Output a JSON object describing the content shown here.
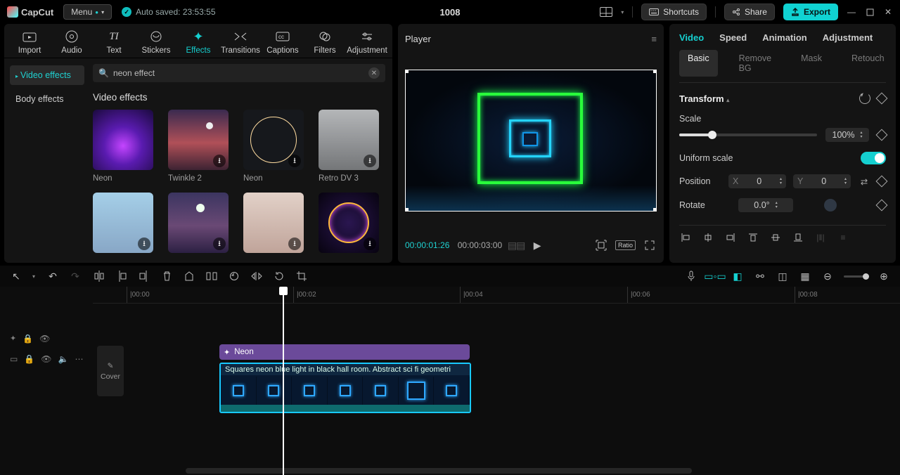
{
  "app": {
    "name": "CapCut",
    "menu": "Menu",
    "autosave": "Auto saved: 23:53:55",
    "project": "1008"
  },
  "topbar": {
    "shortcuts": "Shortcuts",
    "share": "Share",
    "export": "Export"
  },
  "media_tabs": {
    "import": "Import",
    "audio": "Audio",
    "text": "Text",
    "stickers": "Stickers",
    "effects": "Effects",
    "transitions": "Transitions",
    "captions": "Captions",
    "filters": "Filters",
    "adjustment": "Adjustment"
  },
  "media_sidebar": {
    "video_effects": "Video effects",
    "body_effects": "Body effects"
  },
  "search": {
    "value": "neon effect"
  },
  "fx": {
    "section_title": "Video effects",
    "items": [
      {
        "label": "Neon"
      },
      {
        "label": "Twinkle 2"
      },
      {
        "label": "Neon"
      },
      {
        "label": "Retro DV 3"
      },
      {
        "label": ""
      },
      {
        "label": ""
      },
      {
        "label": ""
      },
      {
        "label": ""
      }
    ]
  },
  "player": {
    "title": "Player",
    "current": "00:00:01:26",
    "duration": "00:00:03:00",
    "ratio": "Ratio"
  },
  "inspector": {
    "tabs": {
      "video": "Video",
      "speed": "Speed",
      "animation": "Animation",
      "adjustment": "Adjustment"
    },
    "subtabs": {
      "basic": "Basic",
      "removebg": "Remove BG",
      "mask": "Mask",
      "retouch": "Retouch"
    },
    "transform": "Transform",
    "scale_label": "Scale",
    "scale_value": "100%",
    "uniform_label": "Uniform scale",
    "position_label": "Position",
    "x_label": "X",
    "x_value": "0",
    "y_label": "Y",
    "y_value": "0",
    "rotate_label": "Rotate",
    "rotate_value": "0.0°"
  },
  "timeline": {
    "ticks": [
      "00:00",
      "00:02",
      "00:04",
      "00:06",
      "00:08"
    ],
    "effect_clip": "Neon",
    "video_clip_title": "Squares neon blue light in black hall room. Abstract sci fi geometri",
    "cover": "Cover"
  }
}
